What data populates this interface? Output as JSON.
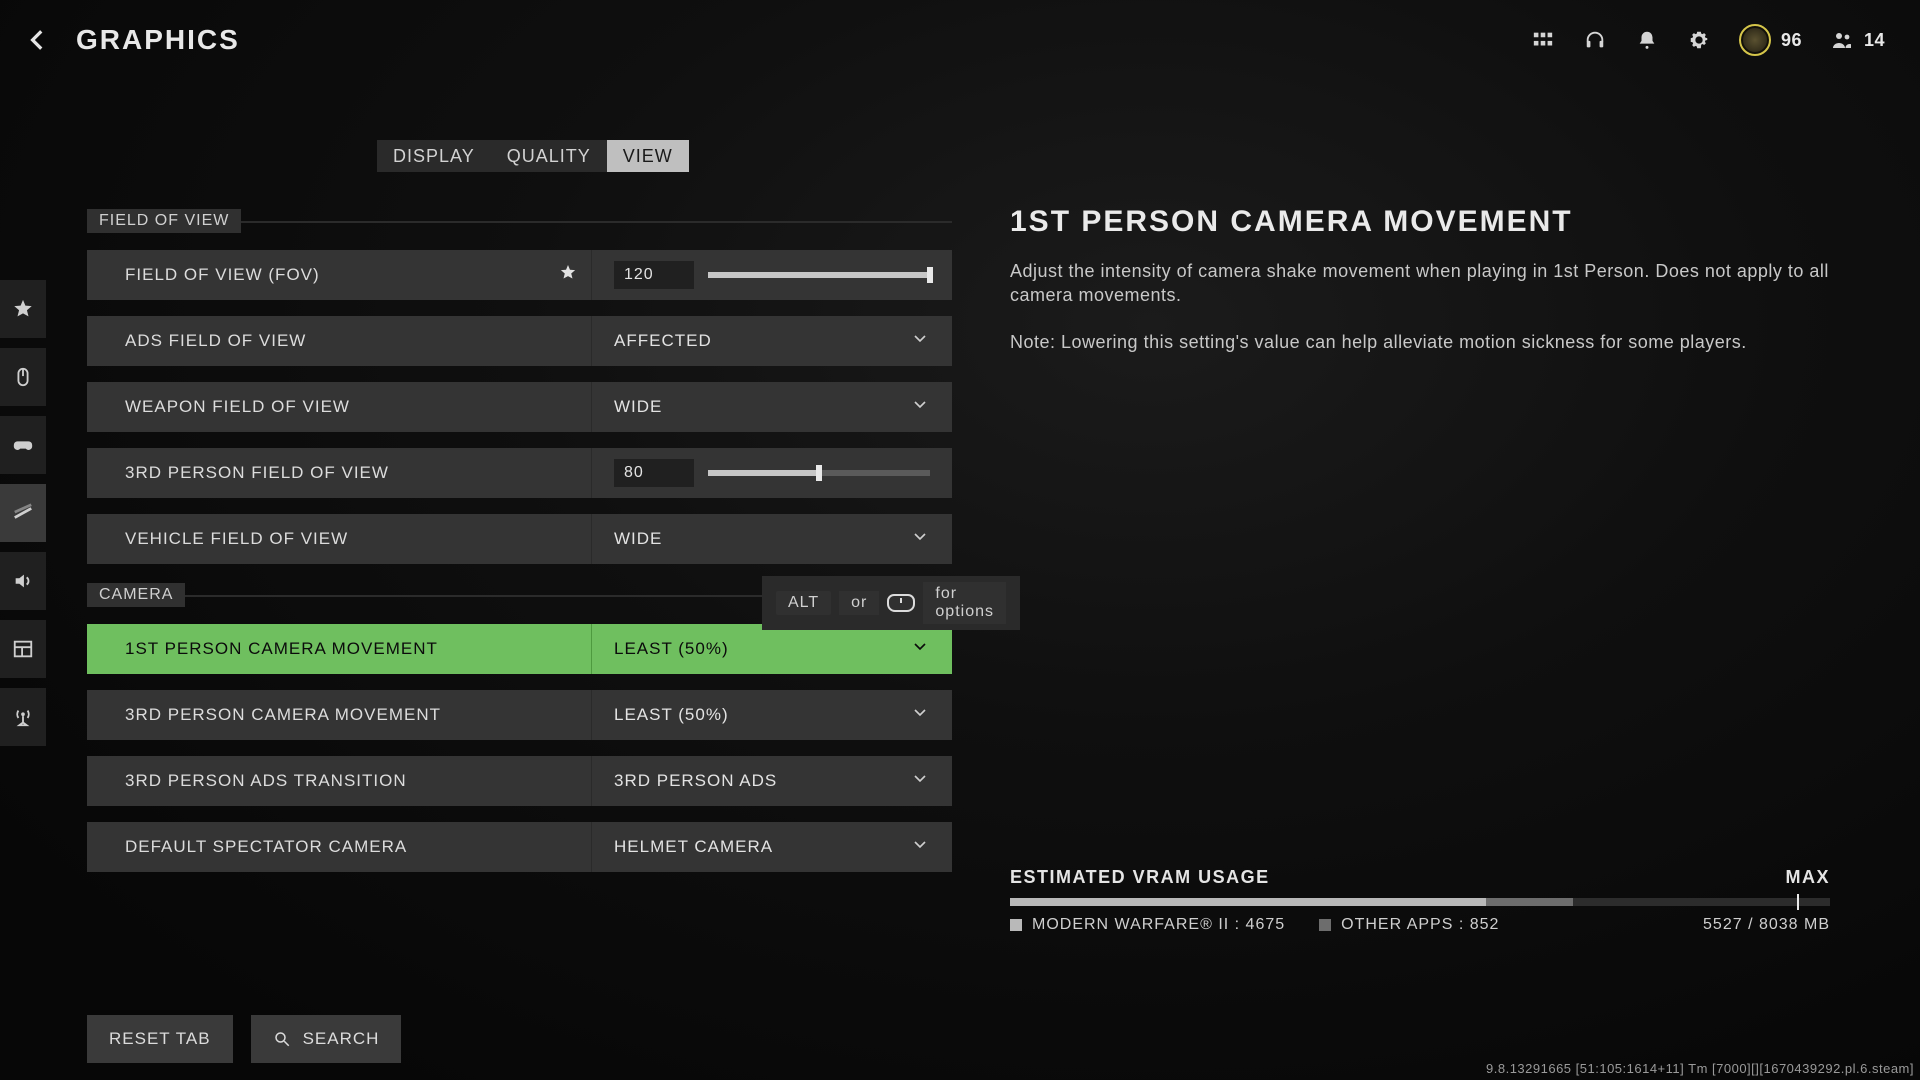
{
  "header": {
    "title": "GRAPHICS",
    "currency": "96",
    "party": "14"
  },
  "tabs": [
    "DISPLAY",
    "QUALITY",
    "VIEW"
  ],
  "active_tab": 2,
  "sections": {
    "s1_title": "FIELD OF VIEW",
    "s2_title": "CAMERA"
  },
  "rows": {
    "fov": {
      "label": "FIELD OF VIEW (FOV)",
      "value": "120"
    },
    "ads_fov": {
      "label": "ADS FIELD OF VIEW",
      "value": "AFFECTED"
    },
    "weapon_fov": {
      "label": "WEAPON FIELD OF VIEW",
      "value": "WIDE"
    },
    "third_fov": {
      "label": "3RD PERSON FIELD OF VIEW",
      "value": "80"
    },
    "vehicle_fov": {
      "label": "VEHICLE FIELD OF VIEW",
      "value": "WIDE"
    },
    "cam1": {
      "label": "1ST PERSON CAMERA MOVEMENT",
      "value": "LEAST (50%)"
    },
    "cam3": {
      "label": "3RD PERSON CAMERA MOVEMENT",
      "value": "LEAST (50%)"
    },
    "ads_trans": {
      "label": "3RD PERSON ADS TRANSITION",
      "value": "3RD PERSON ADS"
    },
    "spectator": {
      "label": "DEFAULT SPECTATOR CAMERA",
      "value": "HELMET CAMERA"
    }
  },
  "hint": {
    "key": "ALT",
    "mid": "or",
    "tail": "for options"
  },
  "desc": {
    "title": "1ST PERSON CAMERA MOVEMENT",
    "p1": "Adjust the intensity of camera shake movement when playing in 1st Person. Does not apply to all camera movements.",
    "p2": "Note: Lowering this setting's value can help alleviate motion sickness for some players."
  },
  "vram": {
    "title": "ESTIMATED VRAM USAGE",
    "max": "MAX",
    "game_label": "MODERN WARFARE® II : 4675",
    "other_label": "OTHER APPS : 852",
    "total": "5527 / 8038 MB"
  },
  "bottom": {
    "reset": "RESET TAB",
    "search": "SEARCH"
  },
  "build": "9.8.13291665 [51:105:1614+11] Tm [7000][][1670439292.pl.6.steam]"
}
